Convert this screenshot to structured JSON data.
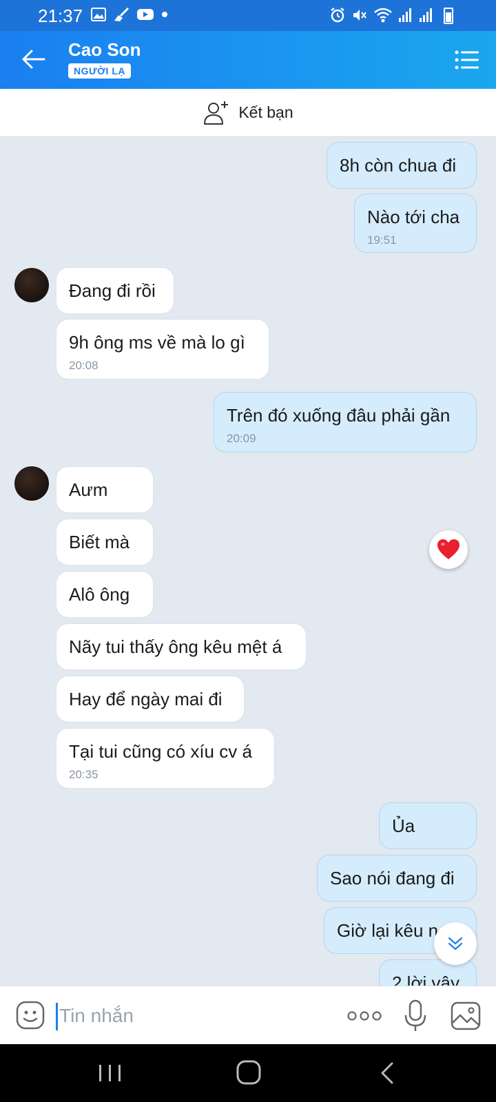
{
  "status_bar": {
    "time": "21:37",
    "left_icons": [
      "image-icon",
      "broom-icon",
      "youtube-icon",
      "dot-icon"
    ],
    "right_icons": [
      "alarm-icon",
      "mute-icon",
      "wifi-icon",
      "signal-icon",
      "signal-icon",
      "battery-icon"
    ]
  },
  "header": {
    "contact_name": "Cao Son",
    "badge": "NGƯỜI LẠ",
    "colors": {
      "start": "#1a7ff0",
      "end": "#1aa7ef"
    }
  },
  "add_friend": {
    "label": "Kết bạn"
  },
  "messages": [
    {
      "side": "out",
      "text": "8h còn chua đi",
      "time": ""
    },
    {
      "side": "out",
      "text": "Nào tới cha",
      "time": "19:51"
    },
    {
      "side": "in",
      "text": "Đang đi rồi",
      "time": ""
    },
    {
      "side": "in",
      "text": "9h ông ms về mà lo gì",
      "time": "20:08"
    },
    {
      "side": "out",
      "text": "Trên đó xuống đâu phải gần",
      "time": "20:09"
    },
    {
      "side": "in",
      "text": "Aưm",
      "time": ""
    },
    {
      "side": "in",
      "text": "Biết mà",
      "time": ""
    },
    {
      "side": "in",
      "text": "Alô ông",
      "time": ""
    },
    {
      "side": "in",
      "text": "Nãy tui thấy ông kêu mệt á",
      "time": ""
    },
    {
      "side": "in",
      "text": "Hay để ngày mai đi",
      "time": ""
    },
    {
      "side": "in",
      "text": "Tại tui cũng có xíu cv á",
      "time": "20:35"
    },
    {
      "side": "out",
      "text": "Ủa",
      "time": ""
    },
    {
      "side": "out",
      "text": "Sao nói đang đi",
      "time": ""
    },
    {
      "side": "out",
      "text": "Giờ lại kêu n",
      "time": ""
    },
    {
      "side": "out",
      "text": "2 lời vậy",
      "time": ""
    }
  ],
  "reaction": {
    "icon": "heart-icon",
    "color": "#e8202f"
  },
  "composer": {
    "placeholder": "Tin nhắn",
    "value": ""
  },
  "colors": {
    "chat_bg": "#e2e9f1",
    "bubble_out": "#d5ecfc",
    "bubble_in": "#ffffff",
    "accent": "#1a7ff0"
  }
}
